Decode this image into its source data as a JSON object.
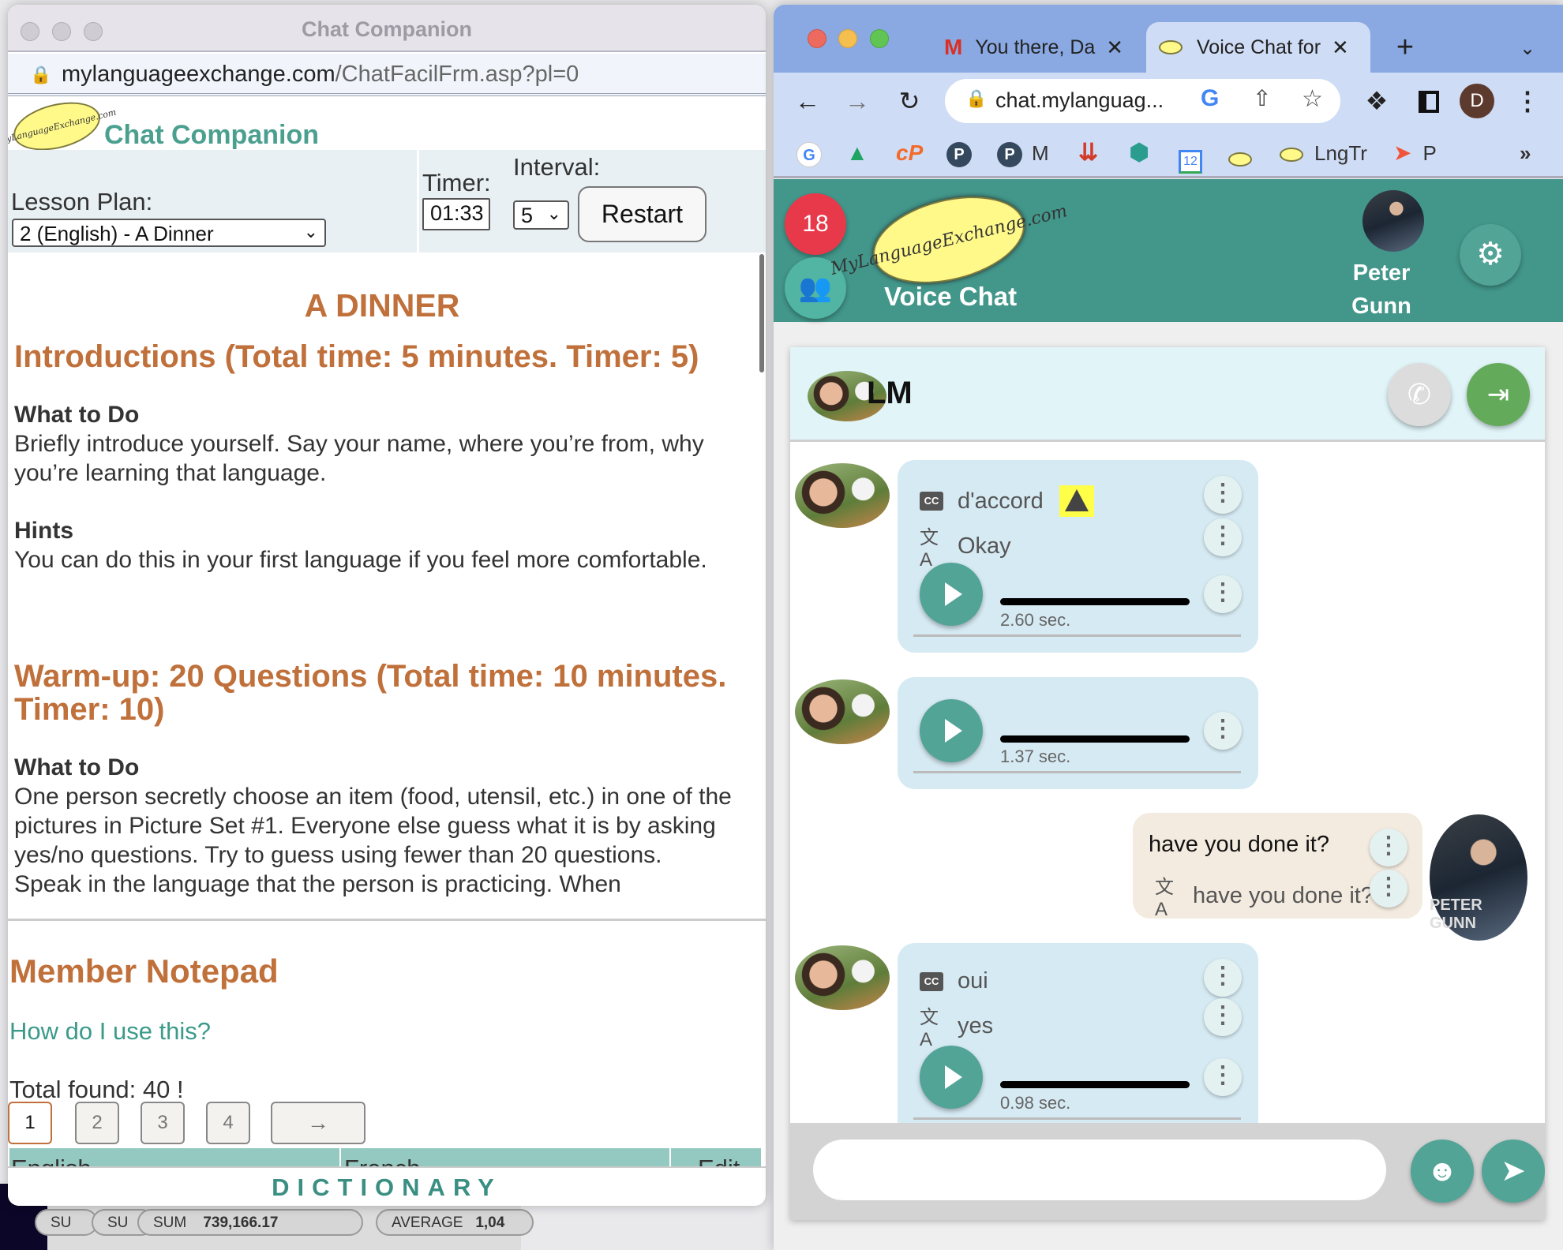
{
  "background_sheet": {
    "pills": [
      "SU",
      "SU",
      "SUM",
      "AVERAGE"
    ],
    "sum_value": "739,166.17",
    "average_value": "1,04"
  },
  "left_window": {
    "title": "Chat Companion",
    "url_domain": "mylanguageexchange.com",
    "url_path": "/ChatFacilFrm.asp?pl=0",
    "logo_text": "MyLanguageExchange.com",
    "app_title": "Chat Companion",
    "lesson_plan_label": "Lesson Plan:",
    "lesson_plan_value": "2 (English) - A Dinner",
    "timer_label": "Timer:",
    "timer_value": "01:33",
    "interval_label": "Interval:",
    "interval_value": "5",
    "restart_label": "Restart",
    "lesson": {
      "title": "A DINNER",
      "sections": [
        {
          "heading": "Introductions (Total time: 5 minutes. Timer: 5)",
          "what_label": "What to Do",
          "what_text": "Briefly introduce yourself. Say your name, where you’re from, why you’re learning that language.",
          "hints_label": "Hints",
          "hints_text": "You can do this in your first language if you feel more comfortable."
        },
        {
          "heading": "Warm-up: 20 Questions (Total time: 10 minutes. Timer: 10)",
          "what_label": "What to Do",
          "what_text": "One person secretly choose an item (food, utensil, etc.) in one of the pictures in Picture Set #1. Everyone else guess what it is by asking yes/no questions. Try to guess using fewer than 20 questions.",
          "cut_text": "Speak in the language that the person is practicing. When"
        }
      ]
    },
    "notepad": {
      "title": "Member Notepad",
      "help_link": "How do I use this?",
      "total_found": "Total found: 40 !",
      "pages": [
        "1",
        "2",
        "3",
        "4"
      ],
      "active_page": "1",
      "next_label": "→",
      "columns": [
        "English",
        "French",
        "Edit"
      ]
    },
    "dictionary_label": "DICTIONARY"
  },
  "browser": {
    "tabs": [
      {
        "title": "You there, Da",
        "icon": "gmail-icon",
        "active": false
      },
      {
        "title": "Voice Chat for",
        "icon": "mle-logo-icon",
        "active": true
      }
    ],
    "new_tab": "+",
    "url": "chat.mylanguag...",
    "profile_initial": "D",
    "bookmarks": [
      {
        "icon": "google-icon",
        "label": ""
      },
      {
        "icon": "drive-icon",
        "label": ""
      },
      {
        "icon": "cpanel-icon",
        "label": ""
      },
      {
        "icon": "p-icon",
        "label": ""
      },
      {
        "icon": "p-icon",
        "label": "M"
      },
      {
        "icon": "todoist-icon",
        "label": ""
      },
      {
        "icon": "hex-icon",
        "label": ""
      },
      {
        "icon": "calendar-icon",
        "label": "12"
      },
      {
        "icon": "mle-logo-icon",
        "label": ""
      },
      {
        "icon": "mle-logo-icon",
        "label": "LngTr"
      },
      {
        "icon": "rocket-icon",
        "label": "P"
      }
    ],
    "more_bookmarks": "»"
  },
  "voice_chat": {
    "badge_count": "18",
    "title": "Voice Chat",
    "logo_text": "MyLanguageExchange.com",
    "user_name_line1": "Peter",
    "user_name_line2": "Gunn",
    "user_avatar_text": "PETER GUNN",
    "partner_name": "LM",
    "messages": [
      {
        "from": "partner",
        "caption": "d'accord",
        "warning": true,
        "translation": "Okay",
        "duration": "2.60 sec."
      },
      {
        "from": "partner",
        "duration": "1.37 sec."
      },
      {
        "from": "me",
        "text": "have you done it?",
        "translation": "have you done it?"
      },
      {
        "from": "partner",
        "caption": "oui",
        "translation": "yes",
        "duration": "0.98 sec."
      }
    ],
    "input_value": "",
    "colors": {
      "header": "#42968a",
      "accent": "#52a497",
      "badge": "#e8394b",
      "partner_bubble": "#d6eaf3",
      "my_bubble": "#f3ebdf",
      "heading_orange": "#c0703a"
    }
  }
}
